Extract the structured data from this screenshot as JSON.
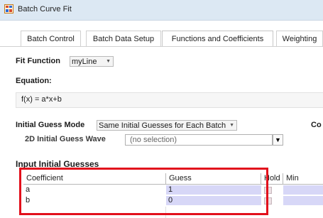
{
  "window": {
    "title": "Batch Curve Fit",
    "icon": "batch-curve-fit-app-icon"
  },
  "tabs": [
    {
      "label": "Batch Control",
      "active": false
    },
    {
      "label": "Batch Data Setup",
      "active": false
    },
    {
      "label": "Functions and Coefficients",
      "active": true
    },
    {
      "label": "Weighting",
      "active": false
    }
  ],
  "fit_function": {
    "label": "Fit Function",
    "value": "myLine"
  },
  "equation": {
    "label": "Equation:",
    "text": "f(x) = a*x+b"
  },
  "initial_guess_mode": {
    "label": "Initial Guess Mode",
    "value": "Same Initial Guesses for Each Batch",
    "clipped_text": "Co"
  },
  "guess_wave": {
    "label": "2D Initial Guess Wave",
    "value": "(no selection)"
  },
  "guesses": {
    "heading": "Input Initial Guesses",
    "columns": [
      "Coefficient",
      "Guess",
      "Hold",
      "Min"
    ],
    "rows": [
      {
        "coefficient": "a",
        "guess": "1"
      },
      {
        "coefficient": "b",
        "guess": "0"
      }
    ]
  },
  "colors": {
    "highlight": "#e2101c",
    "editable_cell": "#d7d7f7",
    "titlebar": "#dce8f3"
  }
}
